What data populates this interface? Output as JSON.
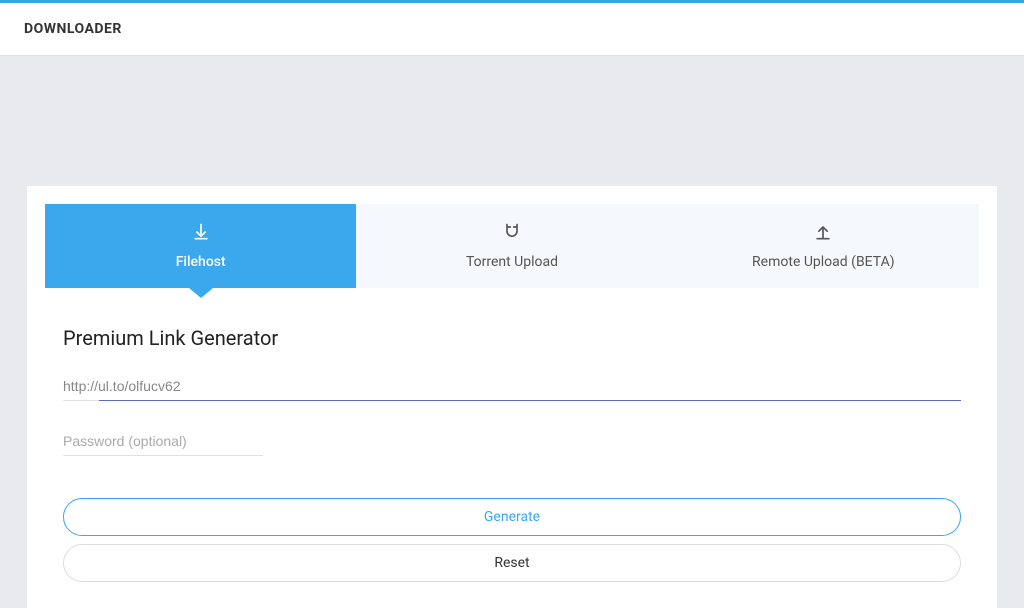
{
  "header": {
    "title": "DOWNLOADER"
  },
  "tabs": [
    {
      "label": "Filehost",
      "active": true
    },
    {
      "label": "Torrent Upload",
      "active": false
    },
    {
      "label": "Remote Upload (BETA)",
      "active": false
    }
  ],
  "section": {
    "title": "Premium Link Generator"
  },
  "form": {
    "url_value": "http://ul.to/olfucv62",
    "password_placeholder": "Password (optional)",
    "generate_label": "Generate",
    "reset_label": "Reset"
  }
}
